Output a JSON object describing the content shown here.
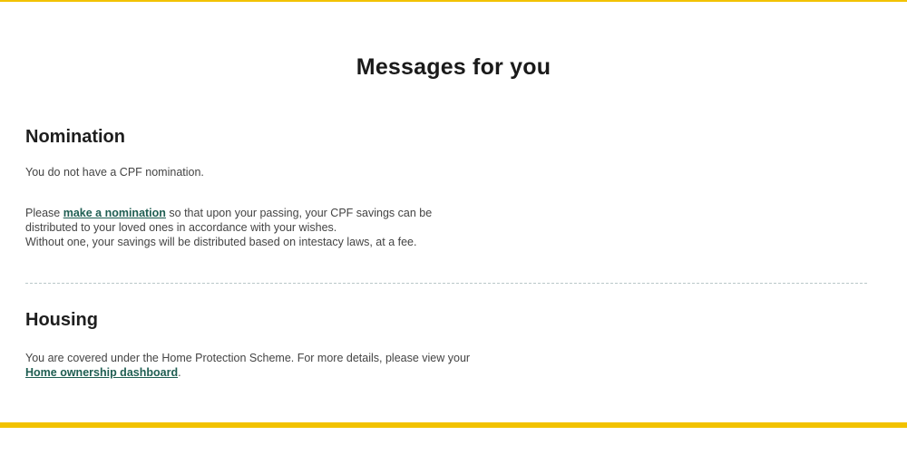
{
  "title": "Messages for you",
  "nomination": {
    "heading": "Nomination",
    "status_text": "You do not have a CPF nomination.",
    "para_prefix": "Please ",
    "link_label": "make a nomination",
    "para_line1_suffix": " so that upon your passing, your CPF savings can be",
    "para_line2": "distributed to your loved ones in accordance with your wishes.",
    "para_line3": "Without one, your savings will be distributed based on intestacy laws, at a fee."
  },
  "housing": {
    "heading": "Housing",
    "para_line1": "You are covered under the Home Protection Scheme. For more details, please view your",
    "link_label": "Home ownership dashboard",
    "para_suffix": "."
  },
  "colors": {
    "accent_border": "#f2c200",
    "link": "#1f5e52",
    "divider": "#b9c8c9"
  }
}
